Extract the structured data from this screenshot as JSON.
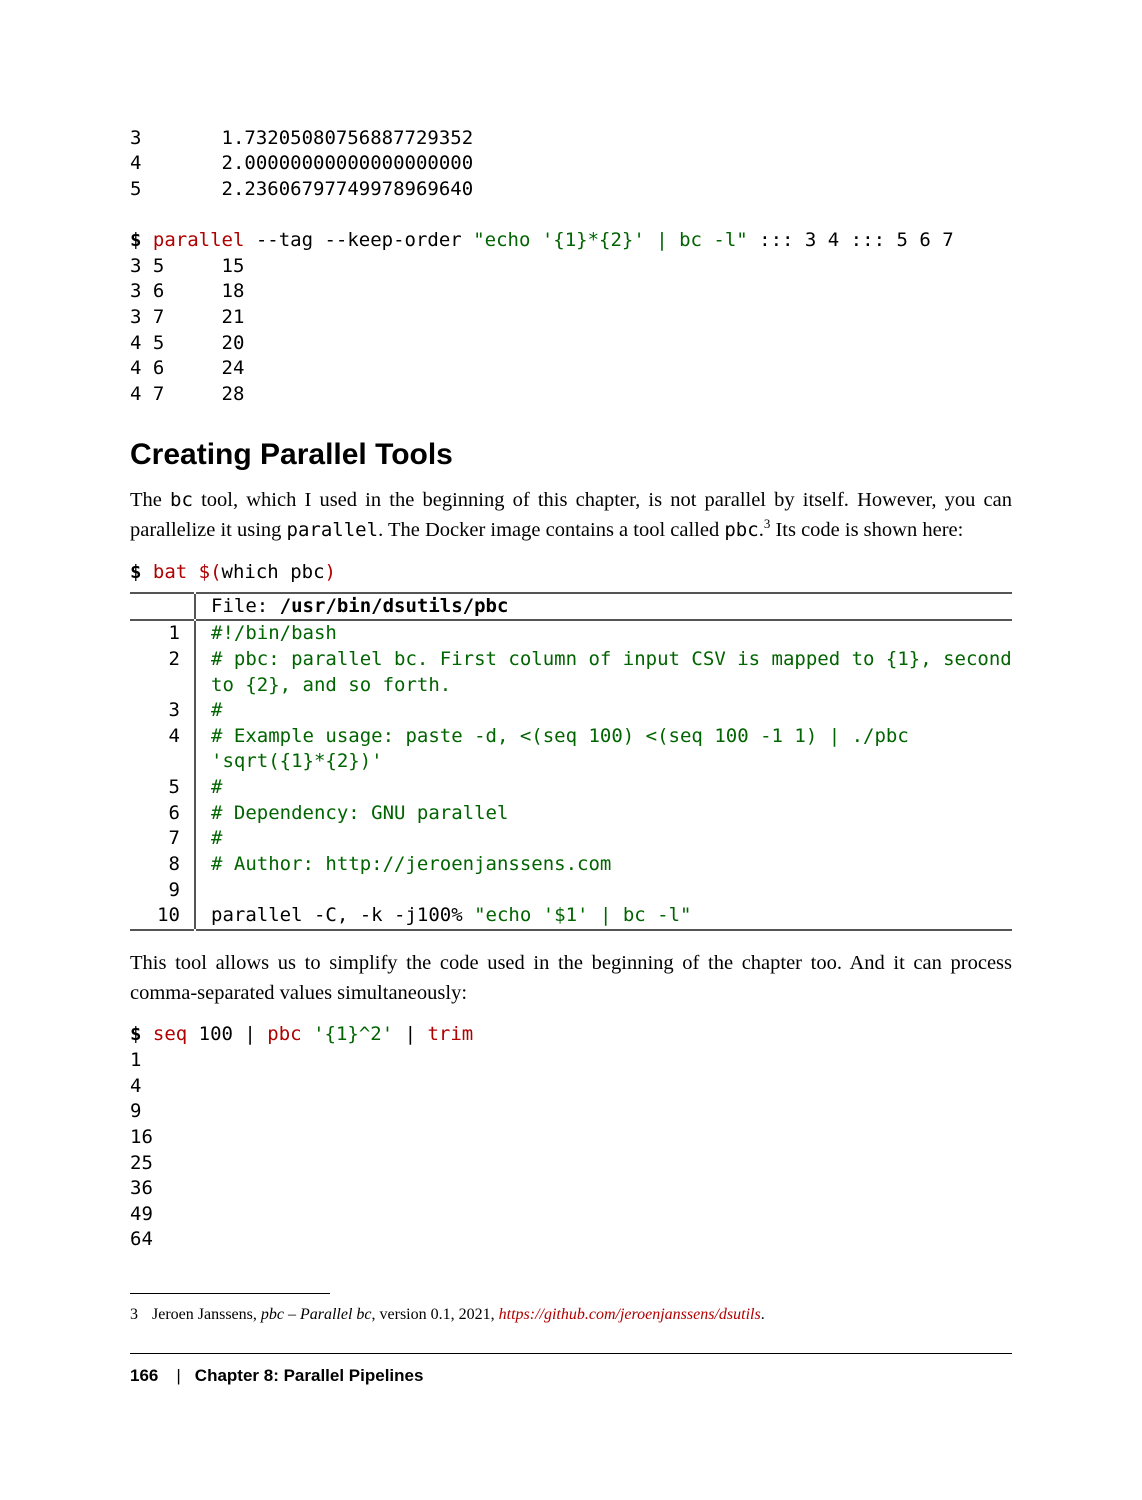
{
  "code_top": {
    "lines": [
      "3       1.73205080756887729352",
      "4       2.00000000000000000000",
      "5       2.23606797749978969640",
      ""
    ],
    "cmd_prompt": "$",
    "cmd_name": " parallel",
    "cmd_args": " --tag --keep-order ",
    "cmd_str": "\"echo '{1}*{2}' | bc -l\"",
    "cmd_tail": " ::: 3 4 ::: 5 6 7",
    "out": [
      "3 5     15",
      "3 6     18",
      "3 7     21",
      "4 5     20",
      "4 6     24",
      "4 7     28"
    ]
  },
  "heading": "Creating Parallel Tools",
  "para1_a": "The ",
  "para1_code1": "bc",
  "para1_b": " tool, which I used in the beginning of this chapter, is not parallel by itself. However, you can parallelize it using ",
  "para1_code2": "parallel",
  "para1_c": ". The Docker image contains a tool called ",
  "para1_code3": "pbc",
  "para1_d": ".",
  "para1_sup": "3",
  "para1_e": " Its code is shown here:",
  "bat_cmd": {
    "prompt": "$",
    "cmd": " bat ",
    "dollarsub": "$(",
    "which": "which",
    "arg": " pbc",
    "close": ")"
  },
  "bat": {
    "file_label": "File: ",
    "file_path": "/usr/bin/dsutils/pbc",
    "rows": [
      {
        "n": "1",
        "t": "#!/bin/bash",
        "c": true
      },
      {
        "n": "2",
        "t": "# pbc: parallel bc. First column of input CSV is mapped to {1}, second to {2}, and so forth.",
        "c": true
      },
      {
        "n": "3",
        "t": "#",
        "c": true
      },
      {
        "n": "4",
        "t": "# Example usage: paste -d, <(seq 100) <(seq 100 -1 1) | ./pbc 'sqrt({1}*{2})'",
        "c": true
      },
      {
        "n": "5",
        "t": "#",
        "c": true
      },
      {
        "n": "6",
        "t": "# Dependency: GNU parallel",
        "c": true
      },
      {
        "n": "7",
        "t": "#",
        "c": true
      },
      {
        "n": "8",
        "t": "# Author: http://jeroenjanssens.com",
        "c": true
      },
      {
        "n": "9",
        "t": "",
        "c": false
      }
    ],
    "last_n": "10",
    "last_plain": "parallel -C, -k -j100% ",
    "last_str": "\"echo '$1' | bc -l\""
  },
  "para2": "This tool allows us to simplify the code used in the beginning of the chapter too. And it can process comma-separated values simultaneously:",
  "code_bottom": {
    "prompt": "$",
    "c1": " seq",
    "a1": " 100 | ",
    "c2": "pbc ",
    "s2": "'{1}^2'",
    "a2": " | ",
    "c3": "trim",
    "out": [
      "1",
      "4",
      "9",
      "16",
      "25",
      "36",
      "49",
      "64"
    ]
  },
  "footnote": {
    "num": "3",
    "author": "Jeroen Janssens, ",
    "title": "pbc – Parallel bc",
    "rest": ", version 0.1, 2021, ",
    "link": "https://github.com/jeroenjanssens/dsutils",
    "dot": "."
  },
  "footer": {
    "page": "166",
    "sep": "|",
    "chapter": "Chapter 8: Parallel Pipelines"
  },
  "chart_data": {
    "type": "table",
    "title": "Document page (no numeric chart)",
    "categories": [],
    "values": []
  }
}
